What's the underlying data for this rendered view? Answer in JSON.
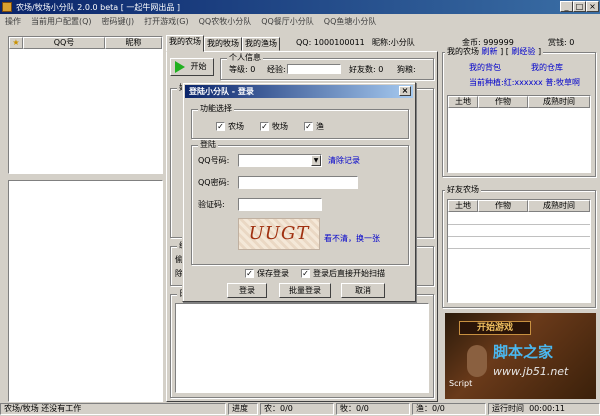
{
  "window": {
    "title": "农场/牧场小分队  2.0.0 beta  [ 一起牛网出品 ]",
    "minimize": "_",
    "maximize": "□",
    "close": "×"
  },
  "menu": [
    "操作",
    "当前用户配置(Q)",
    "密码键(J)",
    "打开游戏(G)",
    "QQ农牧小分队",
    "QQ餐厅小分队",
    "QQ鱼塘小分队"
  ],
  "friend_list": {
    "columns": [
      "QQ号",
      "昵称"
    ]
  },
  "tabs": [
    "我的农场",
    "我的牧场",
    "我的渔场"
  ],
  "account_bar": {
    "qq_label": "QQ:",
    "qq": "1000100011",
    "nick_label": "昵称:",
    "nick": "小分队",
    "gold_label": "金币:",
    "gold": "999999",
    "reward_label": "赏钱:",
    "reward": "0"
  },
  "start_button": "开始",
  "personal_info": {
    "legend": "个人信息",
    "level_label": "等级:",
    "level": "0",
    "exp_label": "经验:",
    "friend_count_label": "好友数:",
    "friend_count": "0",
    "dog_label": "狗粮:"
  },
  "friends_group_legend": "好",
  "log_group_legend": "日",
  "stats": {
    "legend": "统",
    "line1": "偷",
    "line2": "除"
  },
  "my_farm": {
    "title": "我的农场",
    "refresh": "刷新",
    "brush_exp": "刷经验",
    "backpack": "我的背包",
    "warehouse": "我的仓库",
    "seed_status": "当前种植:红:xxxxxx 普:牧草啊",
    "columns": [
      "土地",
      "作物",
      "成熟时间"
    ]
  },
  "friend_farm": {
    "title": "好友农场",
    "columns": [
      "土地",
      "作物",
      "成熟时间"
    ]
  },
  "dialog": {
    "title": "登陆小分队 - 登录",
    "close": "×",
    "function_legend": "功能选择",
    "farm": "农场",
    "pasture": "牧场",
    "fish": "渔",
    "check": "✓",
    "login_legend": "登陆",
    "qq_label": "QQ号码:",
    "clear_records": "清除记录",
    "password_label": "QQ密码:",
    "captcha_label": "验证码:",
    "captcha_text": "UUGT",
    "captcha_refresh": "看不清，换一张",
    "save_login": "保存登录",
    "auto_scan": "登录后直接开始扫描",
    "login_button": "登录",
    "batch_login_button": "批量登录",
    "cancel_button": "取消"
  },
  "ad": {
    "banner": "开始游戏",
    "site": "脚本之家",
    "url": "www.jb51.net",
    "badge": "Script"
  },
  "status": {
    "mode": "农场/牧场 还没有工作",
    "progress_label": "进度",
    "farm": "农：0/0",
    "pasture": "牧：0/0",
    "fish": "渔：0/0",
    "runtime_label": "运行时间",
    "runtime": "00:00:11"
  },
  "colors": {
    "title_bar": "#0a246a",
    "link": "#0000cc",
    "start_icon": "#20b020"
  }
}
